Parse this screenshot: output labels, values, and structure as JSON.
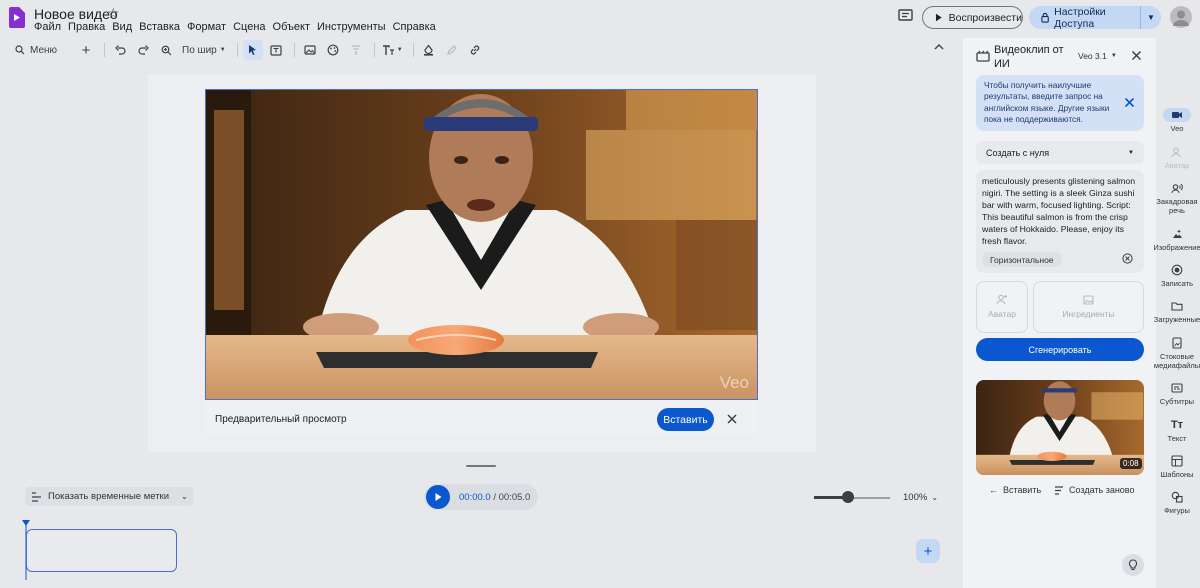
{
  "app": {
    "doc_title": "Новое видео",
    "menu": [
      "Файл",
      "Правка",
      "Вид",
      "Вставка",
      "Формат",
      "Сцена",
      "Объект",
      "Инструменты",
      "Справка"
    ],
    "play_preview": "Воспроизвести",
    "access": "Настройки Доступа"
  },
  "toolbar": {
    "menu_label": "Меню",
    "zoom_label": "По шир"
  },
  "preview": {
    "label": "Предварительный просмотр",
    "insert": "Вставить",
    "watermark": "Veo"
  },
  "timeline": {
    "show_timestamps": "Показать временные метки",
    "time_current": "00:00.0",
    "time_sep": " / ",
    "time_total": "00:05.0",
    "zoom": "100%",
    "zoom_fraction": 0.45
  },
  "panel": {
    "title": "Видеоклип от ИИ",
    "model": "Veo 3.1",
    "info": "Чтобы получить наилучшие результаты, введите запрос на английском языке. Другие языки пока не поддерживаются.",
    "create_mode": "Создать с нуля",
    "prompt": "meticulously presents glistening salmon nigiri. The setting is a sleek Ginza sushi bar with warm, focused lighting. Script: This beautiful salmon is from the crisp waters of Hokkaido. Please, enjoy its fresh flavor.",
    "orientation": "Горизонтальное",
    "avatar_card": "Аватар",
    "ingredients_card": "Ингредиенты",
    "generate": "Сгенерировать",
    "duration": "0:08",
    "result_insert": "Вставить",
    "result_regen": "Создать заново"
  },
  "rail": [
    {
      "label": "Veo",
      "icon": "veo-icon"
    },
    {
      "label": "Аватар",
      "icon": "avatar-icon"
    },
    {
      "label": "Закадровая речь",
      "icon": "voiceover-icon"
    },
    {
      "label": "Изображение",
      "icon": "image-icon"
    },
    {
      "label": "Записать",
      "icon": "record-icon"
    },
    {
      "label": "Загруженные",
      "icon": "folder-icon"
    },
    {
      "label": "Стоковые медиафайлы",
      "icon": "stock-media-icon"
    },
    {
      "label": "Субтитры",
      "icon": "subtitles-icon"
    },
    {
      "label": "Текст",
      "icon": "text-icon"
    },
    {
      "label": "Шаблоны",
      "icon": "templates-icon"
    },
    {
      "label": "Фигуры",
      "icon": "shapes-icon"
    }
  ],
  "colors": {
    "accent": "#0b57d0",
    "accent_light": "#c4d8f3",
    "logo": "#8430ce"
  }
}
